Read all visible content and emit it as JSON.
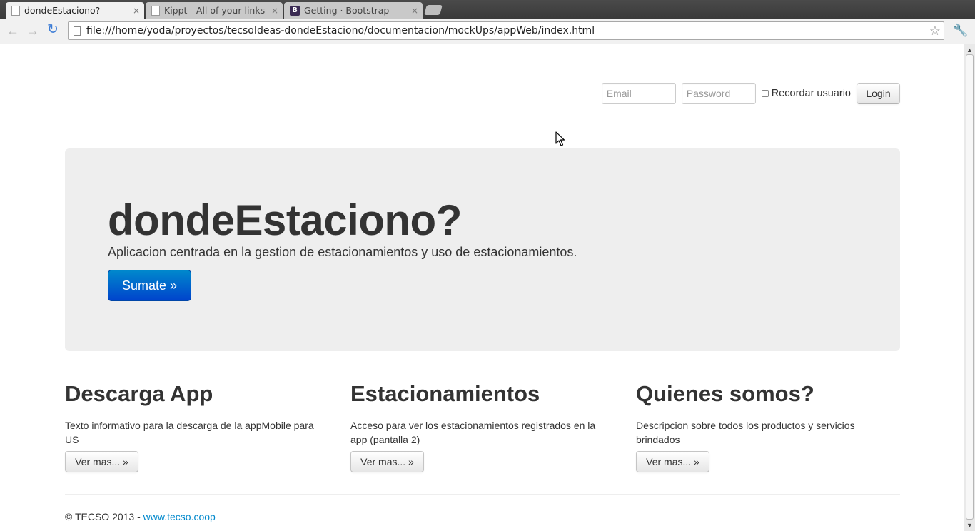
{
  "browser": {
    "tabs": [
      {
        "title": "dondeEstaciono?",
        "close": "×",
        "active": true
      },
      {
        "title": "Kippt - All of your links in o",
        "close": "×",
        "active": false
      },
      {
        "title": "Getting · Bootstrap",
        "close": "×",
        "active": false,
        "favicon": "B"
      }
    ],
    "url": "file:///home/yoda/proyectos/tecsoIdeas-dondeEstaciono/documentacion/mockUps/appWeb/index.html",
    "icons": {
      "back": "←",
      "forward": "→",
      "reload": "↻",
      "star": "☆",
      "wrench": "🔧"
    }
  },
  "login": {
    "email_placeholder": "Email",
    "password_placeholder": "Password",
    "remember_label": "Recordar usuario",
    "login_label": "Login"
  },
  "hero": {
    "title": "dondeEstaciono?",
    "subtitle": "Aplicacion centrada en la gestion de estacionamientos y uso de estacionamientos.",
    "cta": "Sumate »",
    "cta_color": "#0055cc"
  },
  "columns": [
    {
      "title": "Descarga App",
      "text": "Texto informativo para la descarga de la appMobile para US",
      "button": "Ver mas... »"
    },
    {
      "title": "Estacionamientos",
      "text": "Acceso para ver los estacionamientos registrados en la app (pantalla 2)",
      "button": "Ver mas... »"
    },
    {
      "title": "Quienes somos?",
      "text": "Descripcion sobre todos los productos y servicios brindados",
      "button": "Ver mas... »"
    }
  ],
  "footer": {
    "copyright": "© TECSO 2013 - ",
    "link_text": "www.tecso.coop",
    "link_color": "#0088cc"
  }
}
